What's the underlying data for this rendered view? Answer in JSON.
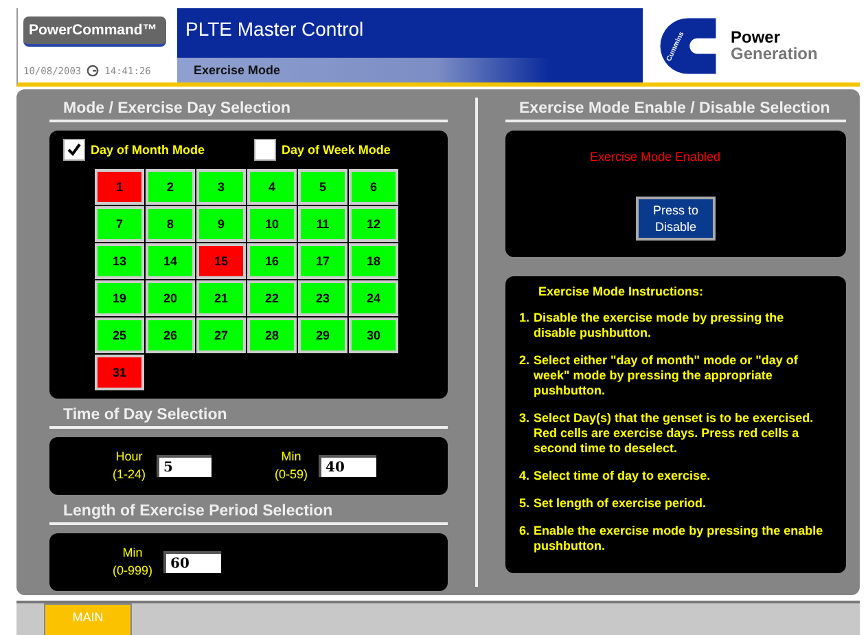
{
  "header": {
    "brand": "PowerCommand™",
    "title": "PLTE Master Control",
    "date": "10/08/2003",
    "time": "14:41:26",
    "screen": "Exercise Mode",
    "logo_mark": "Cummins",
    "logo_line1": "Power",
    "logo_line2": "Generation"
  },
  "day_selection": {
    "heading": "Mode / Exercise Day Selection",
    "modes": [
      {
        "label": "Day of Month Mode",
        "checked": true
      },
      {
        "label": "Day of Week Mode",
        "checked": false
      }
    ],
    "days": [
      {
        "label": "1",
        "selected": true
      },
      {
        "label": "2",
        "selected": false
      },
      {
        "label": "3",
        "selected": false
      },
      {
        "label": "4",
        "selected": false
      },
      {
        "label": "5",
        "selected": false
      },
      {
        "label": "6",
        "selected": false
      },
      {
        "label": "7",
        "selected": false
      },
      {
        "label": "8",
        "selected": false
      },
      {
        "label": "9",
        "selected": false
      },
      {
        "label": "10",
        "selected": false
      },
      {
        "label": "11",
        "selected": false
      },
      {
        "label": "12",
        "selected": false
      },
      {
        "label": "13",
        "selected": false
      },
      {
        "label": "14",
        "selected": false
      },
      {
        "label": "15",
        "selected": true
      },
      {
        "label": "16",
        "selected": false
      },
      {
        "label": "17",
        "selected": false
      },
      {
        "label": "18",
        "selected": false
      },
      {
        "label": "19",
        "selected": false
      },
      {
        "label": "20",
        "selected": false
      },
      {
        "label": "21",
        "selected": false
      },
      {
        "label": "22",
        "selected": false
      },
      {
        "label": "23",
        "selected": false
      },
      {
        "label": "24",
        "selected": false
      },
      {
        "label": "25",
        "selected": false
      },
      {
        "label": "26",
        "selected": false
      },
      {
        "label": "27",
        "selected": false
      },
      {
        "label": "28",
        "selected": false
      },
      {
        "label": "29",
        "selected": false
      },
      {
        "label": "30",
        "selected": false
      },
      {
        "label": "31",
        "selected": true
      }
    ]
  },
  "time_selection": {
    "heading": "Time of Day Selection",
    "fields": [
      {
        "label": "Hour",
        "range": "(1-24)",
        "value": "5"
      },
      {
        "label": "Min",
        "range": "(0-59)",
        "value": "40"
      }
    ]
  },
  "length_selection": {
    "heading": "Length of Exercise Period Selection",
    "fields": [
      {
        "label": "Min",
        "range": "(0-999)",
        "value": "60"
      }
    ]
  },
  "enable_selection": {
    "heading": "Exercise Mode Enable / Disable Selection",
    "status": "Exercise Mode Enabled",
    "button": [
      "Press to",
      "Disable"
    ]
  },
  "instructions": {
    "heading": "Exercise Mode Instructions:",
    "steps": [
      {
        "number": "1.",
        "text": "Disable the exercise mode by pressing the disable pushbutton."
      },
      {
        "number": "2.",
        "text": "Select either \"day of month\" mode or \"day of week\" mode by pressing the appropriate pushbutton."
      },
      {
        "number": "3.",
        "text": "Select Day(s) that the genset is to be exercised. Red cells are exercise days. Press red cells a second time to deselect."
      },
      {
        "number": "4.",
        "text": "Select time of day to exercise."
      },
      {
        "number": "5.",
        "text": "Set length of exercise period."
      },
      {
        "number": "6.",
        "text": "Enable the exercise mode by pressing the enable pushbutton."
      }
    ]
  },
  "footer": {
    "button": "MAIN"
  }
}
